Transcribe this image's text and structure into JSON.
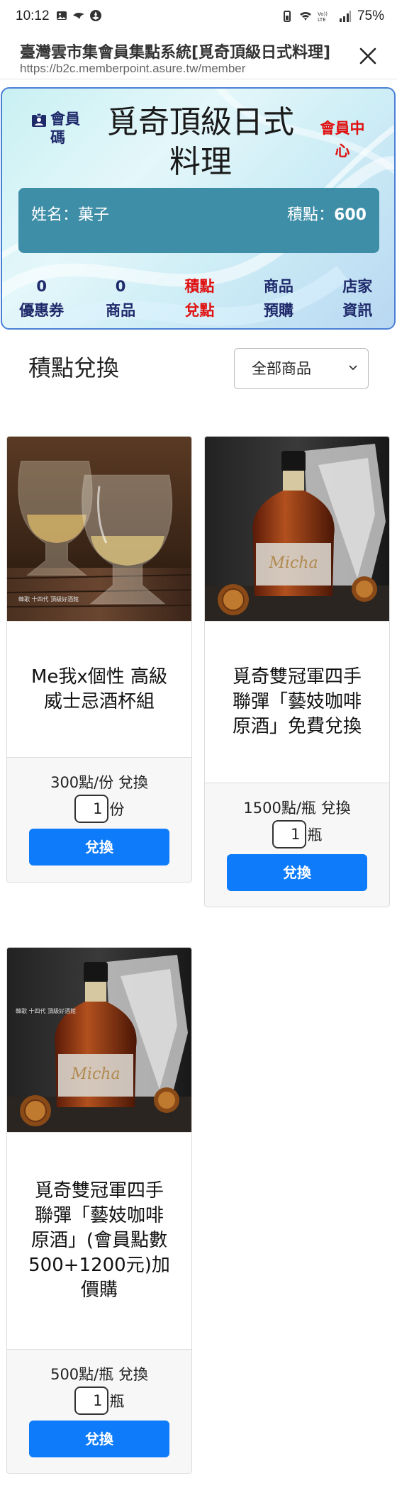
{
  "status_bar": {
    "time": "10:12",
    "battery": "75%",
    "icons": [
      "image-icon",
      "bird-icon",
      "apps-icon",
      "battery-saver-icon",
      "wifi-icon",
      "volte-icon",
      "signal-icon"
    ],
    "volte": "Vo))\nLTE"
  },
  "browser": {
    "title": "臺灣雲市集會員集點系統[覓奇頂級日式料理]",
    "url": "https://b2c.memberpoint.asure.tw/member"
  },
  "member_card": {
    "member_code_label": "會員碼",
    "shop_name": "覓奇頂級日式料理",
    "member_center": "會員中心",
    "name_label": "姓名：菓子",
    "points_label": "積點：",
    "points_value": "600",
    "nav": [
      {
        "top": "0",
        "bottom": "優惠券",
        "highlight": false
      },
      {
        "top": "0",
        "bottom": "商品",
        "highlight": false
      },
      {
        "top": "積點",
        "bottom": "兌點",
        "highlight": true
      },
      {
        "top": "商品",
        "bottom": "預購",
        "highlight": false
      },
      {
        "top": "店家",
        "bottom": "資訊",
        "highlight": false
      }
    ],
    "accent_color": "#e01010",
    "info_bar_color": "#3e8ea8"
  },
  "section": {
    "title": "積點兌換",
    "category_selected": "全部商品"
  },
  "products": [
    {
      "name": "Me我x個性 高級威士忌酒杯組",
      "image_caption": "韓歌 十四代 頂級好酒館",
      "price": "300點/份 兌換",
      "qty": "1",
      "unit": "份",
      "button": "兌換"
    },
    {
      "name": "覓奇雙冠軍四手聯彈「藝妓咖啡原酒」免費兌換",
      "bottle_label": "Micha",
      "price": "1500點/瓶 兌換",
      "qty": "1",
      "unit": "瓶",
      "button": "兌換"
    },
    {
      "name": "覓奇雙冠軍四手聯彈「藝妓咖啡原酒」(會員點數500+1200元)加價購",
      "bottle_label": "Micha",
      "image_caption": "韓歌 十四代 頂級好酒館",
      "price": "500點/瓶 兌換",
      "qty": "1",
      "unit": "瓶",
      "button": "兌換"
    }
  ],
  "button_color": "#0d7bfa"
}
